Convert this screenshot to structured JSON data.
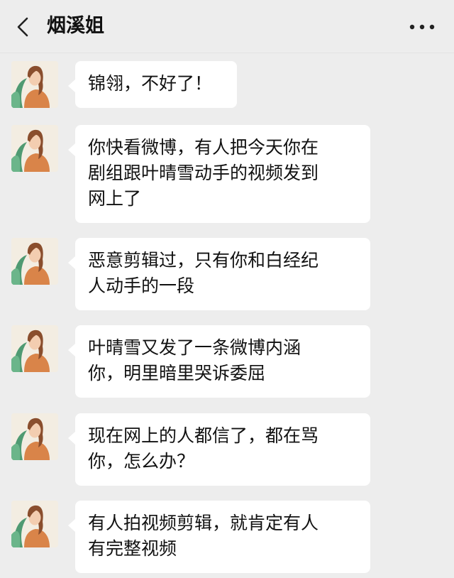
{
  "header": {
    "back_icon": "chevron-left-icon",
    "title": "烟溪姐",
    "more_icon": "more-horizontal-icon"
  },
  "colors": {
    "background": "#ededed",
    "bubble": "#ffffff",
    "text": "#111111"
  },
  "messages": [
    {
      "sender": "烟溪姐",
      "lines": [
        "锦翎，不好了！"
      ]
    },
    {
      "sender": "烟溪姐",
      "lines": [
        "你快看微博，有人把今天你在",
        "剧组跟叶晴雪动手的视频发到",
        "网上了"
      ]
    },
    {
      "sender": "烟溪姐",
      "lines": [
        "恶意剪辑过，只有你和白经纪",
        "人动手的一段"
      ]
    },
    {
      "sender": "烟溪姐",
      "lines": [
        "叶晴雪又发了一条微博内涵",
        "你，明里暗里哭诉委屈"
      ]
    },
    {
      "sender": "烟溪姐",
      "lines": [
        "现在网上的人都信了，都在骂",
        "你，怎么办？"
      ]
    },
    {
      "sender": "烟溪姐",
      "lines": [
        "有人拍视频剪辑，就肯定有人",
        "有完整视频"
      ]
    }
  ]
}
